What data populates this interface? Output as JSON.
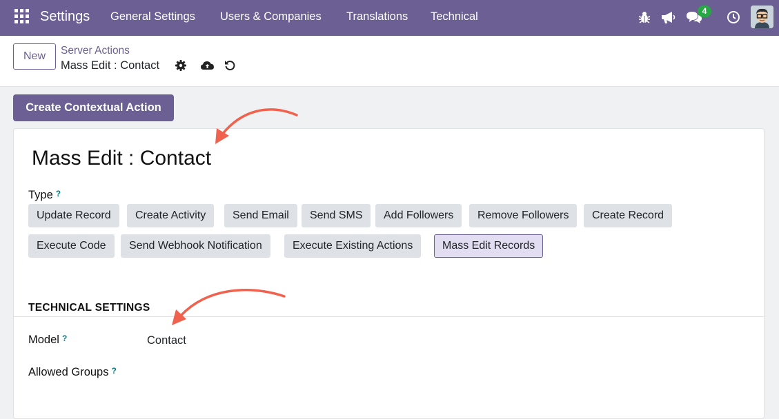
{
  "navbar": {
    "brand": "Settings",
    "menu": [
      "General Settings",
      "Users & Companies",
      "Translations",
      "Technical"
    ],
    "chat_count": "4",
    "color": "#6b5f93"
  },
  "icons": {
    "apps": "apps-grid-icon",
    "debug": "bug-icon",
    "announce": "megaphone-icon",
    "chat": "chat-bubbles-icon",
    "activity": "clock-icon",
    "settings": "gear-icon",
    "save": "cloud-upload-icon",
    "discard": "undo-icon"
  },
  "control_panel": {
    "new_label": "New",
    "breadcrumb_parent": "Server Actions",
    "breadcrumb_current": "Mass Edit : Contact"
  },
  "content": {
    "contextual_action_label": "Create Contextual Action",
    "record_title": "Mass Edit : Contact",
    "type_label": "Type",
    "help_mark": "?",
    "type_options": [
      "Update Record",
      "Create Activity",
      "Send Email",
      "Send SMS",
      "Add Followers",
      "Remove Followers",
      "Create Record",
      "Execute Code",
      "Send Webhook Notification",
      "Execute Existing Actions",
      "Mass Edit Records"
    ],
    "selected_type": "Mass Edit Records",
    "section_title": "TECHNICAL SETTINGS",
    "model_label": "Model",
    "model_value": "Contact",
    "groups_label": "Allowed Groups"
  },
  "annotation_color": "#f0624d"
}
